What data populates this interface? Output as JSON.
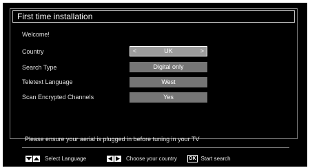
{
  "title": "First time installation",
  "welcome": "Welcome!",
  "rows": [
    {
      "label": "Country",
      "value": "UK",
      "left_arrow": "<",
      "right_arrow": ">"
    },
    {
      "label": "Search Type",
      "value": "Digital only"
    },
    {
      "label": "Teletext Language",
      "value": "West"
    },
    {
      "label": "Scan Encrypted Channels",
      "value": "Yes"
    }
  ],
  "notice": "Please ensure your aerial is plugged in before tuning in your TV",
  "footer": {
    "select_language": "Select Language",
    "choose_country": "Choose your country",
    "ok_label": "OK",
    "start_search": "Start search"
  },
  "colors": {
    "background": "#000000",
    "value_box": "#757575",
    "value_box_selected": "#9c9c9c",
    "text": "#e0e0e0"
  }
}
